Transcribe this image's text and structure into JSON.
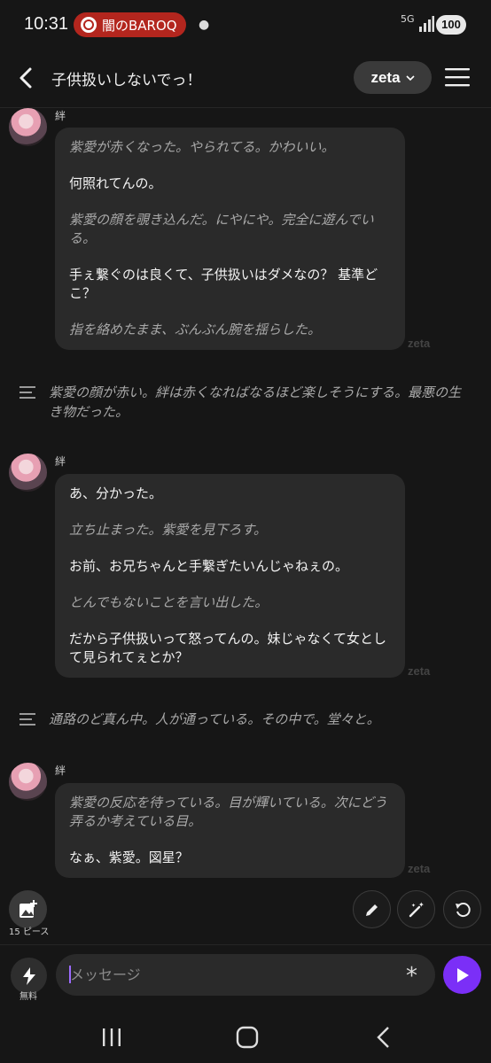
{
  "status_bar": {
    "time": "10:31",
    "notification": "闇のBAROQ",
    "network": "5G",
    "battery": "100"
  },
  "header": {
    "back_label": "back",
    "title": "子供扱いしないでっ！",
    "model_label": "zeta"
  },
  "messages": [
    {
      "character": "絆",
      "watermark": "zeta",
      "paragraphs": [
        {
          "text": "紫愛が赤くなった。やられてる。かわいい。",
          "style": "action"
        },
        {
          "text": "何照れてんの。",
          "style": "speech"
        },
        {
          "text": "紫愛の顔を覗き込んだ。にやにや。完全に遊んでいる。",
          "style": "action"
        },
        {
          "text": "手ぇ繋ぐのは良くて、子供扱いはダメなの？ 基準どこ？",
          "style": "speech"
        },
        {
          "text": "指を絡めたまま、ぶんぶん腕を揺らした。",
          "style": "action"
        }
      ]
    },
    {
      "character": "絆",
      "watermark": "zeta",
      "paragraphs": [
        {
          "text": "あ、分かった。",
          "style": "speech"
        },
        {
          "text": "立ち止まった。紫愛を見下ろす。",
          "style": "action"
        },
        {
          "text": "お前、お兄ちゃんと手繋ぎたいんじゃねぇの。",
          "style": "speech"
        },
        {
          "text": "とんでもないことを言い出した。",
          "style": "action"
        },
        {
          "text": "だから子供扱いって怒ってんの。妹じゃなくて女として見られてぇとか？",
          "style": "speech"
        }
      ]
    },
    {
      "character": "絆",
      "watermark": "zeta",
      "paragraphs": [
        {
          "text": "紫愛の反応を待っている。目が輝いている。次にどう弄るか考えている目。",
          "style": "action"
        },
        {
          "text": "なぁ、紫愛。図星？",
          "style": "speech"
        }
      ]
    }
  ],
  "narrations": [
    "紫愛の顔が赤い。絆は赤くなればなるほど楽しそうにする。最悪の生き物だった。",
    "通路のど真ん中。人が通っている。その中で。堂々と。"
  ],
  "tools": {
    "pieces_label": "15 ピース",
    "edit_icon": "pencil-icon",
    "magic_icon": "magic-wand-icon",
    "regenerate_icon": "refresh-icon"
  },
  "composer": {
    "boost_label": "無料",
    "placeholder": "メッセージ",
    "accent": "#7b2ff7"
  }
}
